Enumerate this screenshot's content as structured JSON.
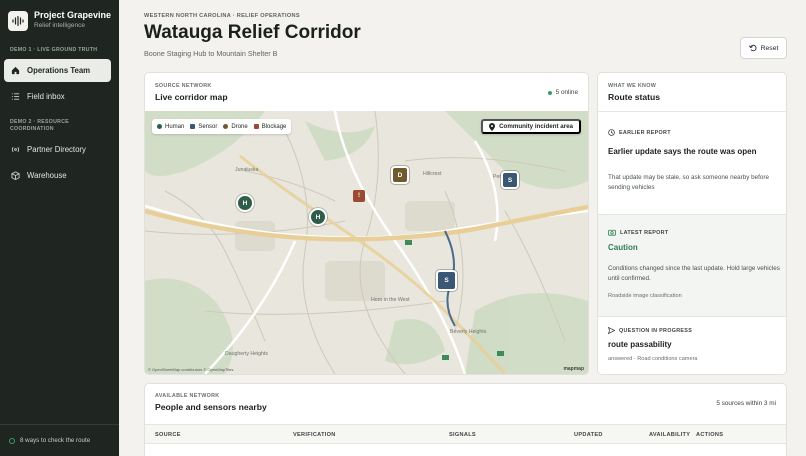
{
  "app": {
    "name": "Project Grapevine",
    "tagline": "Relief intelligence"
  },
  "sidebar": {
    "section1": "DEMO 1 · LIVE GROUND TRUTH",
    "section2": "DEMO 2 · RESOURCE COORDINATION",
    "items": [
      {
        "label": "Operations Team",
        "icon": "home-icon",
        "active": true
      },
      {
        "label": "Field inbox",
        "icon": "inbox-list-icon",
        "active": false
      },
      {
        "label": "Partner Directory",
        "icon": "signal-icon",
        "active": false
      },
      {
        "label": "Warehouse",
        "icon": "box-icon",
        "active": false
      }
    ],
    "footer": "8 ways to check the route"
  },
  "header": {
    "breadcrumb": "WESTERN NORTH CAROLINA · RELIEF OPERATIONS",
    "title": "Watauga Relief Corridor",
    "subtitle": "Boone Staging Hub to Mountain Shelter B",
    "reset_label": "Reset"
  },
  "map_card": {
    "eyebrow": "SOURCE NETWORK",
    "title": "Live corridor map",
    "online": "5 online",
    "legend": [
      {
        "label": "Human",
        "color": "#2e5d4a"
      },
      {
        "label": "Sensor",
        "color": "#3a5773"
      },
      {
        "label": "Drone",
        "color": "#6e5a2c"
      },
      {
        "label": "Blockage",
        "color": "#9b4a34"
      }
    ],
    "community_button": "Community incident area",
    "markers": {
      "human": "H",
      "sensor": "S",
      "drone": "D",
      "blockage": "!"
    },
    "places": [
      "Junaluska",
      "Hillcrest",
      "Perkinsville",
      "Horn in the West",
      "Beverly Heights",
      "Daugherty Heights"
    ],
    "attribution": "© OpenStreetMap contributors © OpenMapTiles",
    "logo": "mapmap"
  },
  "status": {
    "eyebrow": "WHAT WE KNOW",
    "title": "Route status",
    "earlier": {
      "label": "EARLIER REPORT",
      "headline": "Earlier update says the route was open",
      "body": "That update may be stale, so ask someone nearby before sending vehicles"
    },
    "latest": {
      "label": "LATEST REPORT",
      "headline": "Caution",
      "body": "Conditions changed since the last update. Hold large vehicles until confirmed.",
      "meta": "Roadside image classification"
    },
    "question": {
      "label": "QUESTION IN PROGRESS",
      "headline": "route passability",
      "meta": "answered · Road conditions camera"
    }
  },
  "network": {
    "eyebrow": "AVAILABLE NETWORK",
    "title": "People and sensors nearby",
    "count": "5 sources within 3 mi",
    "columns": [
      "SOURCE",
      "VERIFICATION",
      "SIGNALS",
      "UPDATED",
      "AVAILABILITY",
      "ACTIONS"
    ]
  },
  "colors": {
    "sidebar_bg": "#1f2622",
    "accent_green": "#2e7d53",
    "caution": "#2e7d53"
  }
}
